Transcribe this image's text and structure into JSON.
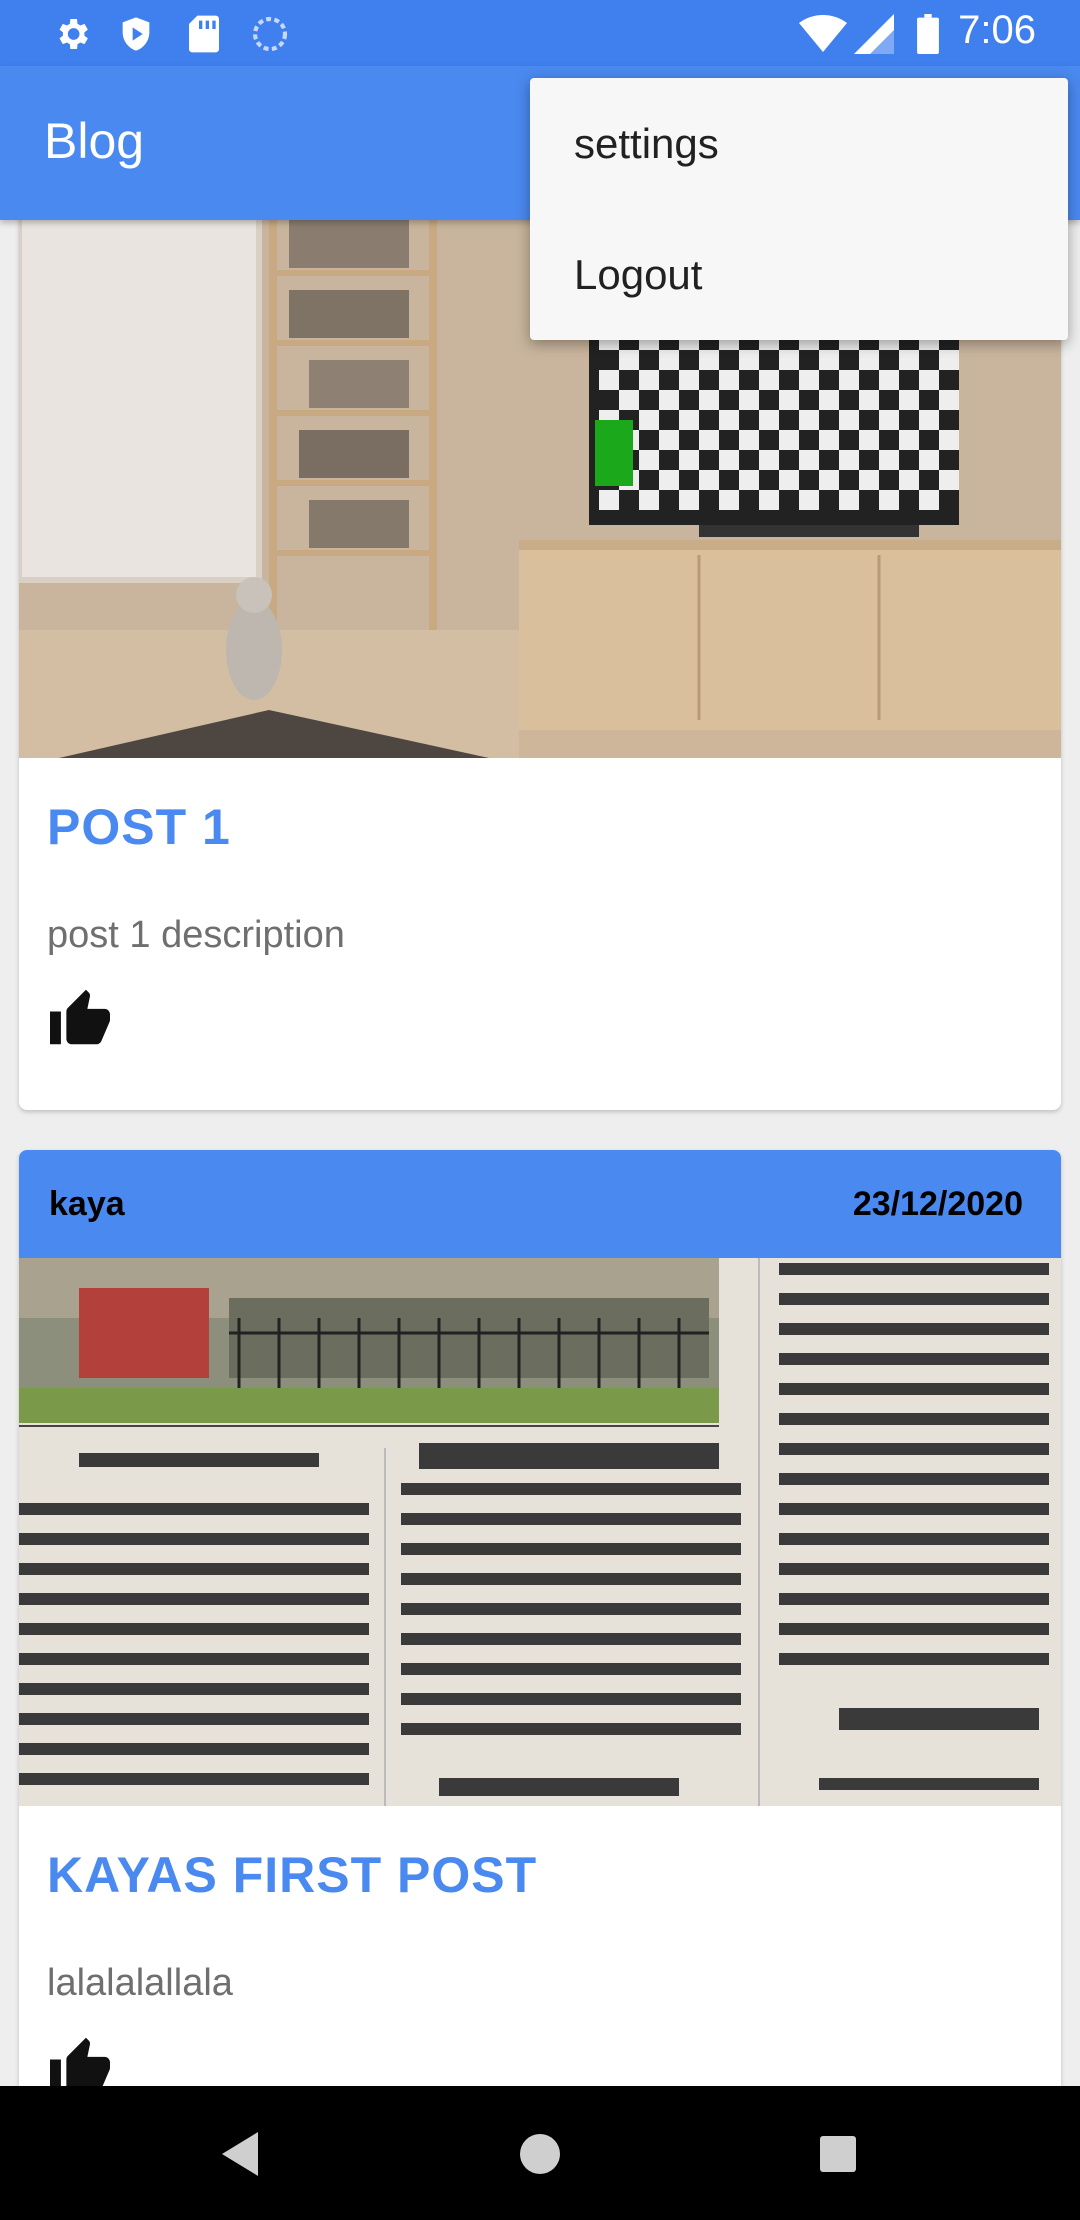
{
  "status_bar": {
    "time": "7:06",
    "left_icons": [
      "gear-icon",
      "shield-play-icon",
      "sd-card-icon",
      "sync-circle-icon"
    ],
    "right_icons": [
      "wifi-icon",
      "signal-icon",
      "battery-icon"
    ]
  },
  "app_bar": {
    "title": "Blog"
  },
  "overflow_menu": {
    "items": [
      {
        "label": "settings"
      },
      {
        "label": "Logout"
      }
    ]
  },
  "posts": [
    {
      "author": "",
      "date": "",
      "image": "room-with-cat-and-tv-photo",
      "title": "POST 1",
      "description": "post 1 description",
      "like_icon": "thumbs-up-icon"
    },
    {
      "author": "kaya",
      "date": "23/12/2020",
      "image": "hindi-newspaper-clipping-photo",
      "title": "KAYAS FIRST POST",
      "description": "lalalalallala",
      "like_icon": "thumbs-up-icon"
    }
  ],
  "nav_bar": {
    "buttons": [
      "back-icon",
      "home-icon",
      "recents-icon"
    ]
  },
  "colors": {
    "primary": "#4a89f0",
    "status_bar": "#3f80ee",
    "title_text": "#4a89f0"
  }
}
